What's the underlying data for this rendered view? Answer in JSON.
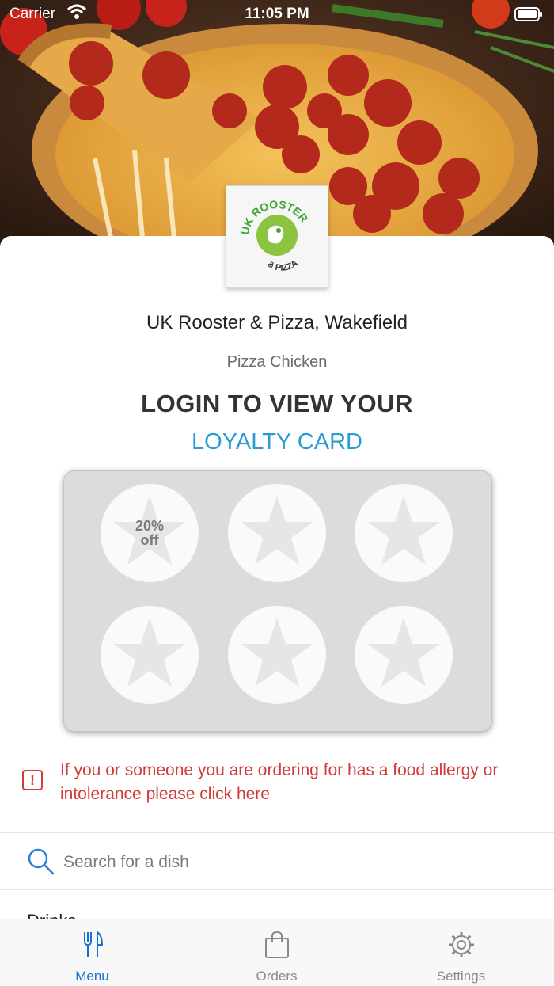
{
  "status_bar": {
    "carrier": "Carrier",
    "time": "11:05 PM"
  },
  "restaurant": {
    "logo_top": "UK ROOSTER",
    "logo_bottom": "& PIZZA",
    "name": "UK Rooster & Pizza, Wakefield",
    "cuisine": "Pizza Chicken"
  },
  "loyalty": {
    "heading": "LOGIN TO VIEW YOUR",
    "subheading": "LOYALTY CARD",
    "reward_percent": "20%",
    "reward_off": "off",
    "stamps_total": 6
  },
  "allergy": {
    "icon": "alert-icon",
    "message": "If you or someone you are ordering for has a food allergy or intolerance please click here"
  },
  "search": {
    "placeholder": "Search for a dish"
  },
  "menu_next_category": "Drinks",
  "tabs": [
    {
      "label": "Menu",
      "icon": "fork-knife-icon",
      "active": true
    },
    {
      "label": "Orders",
      "icon": "bag-icon",
      "active": false
    },
    {
      "label": "Settings",
      "icon": "gear-icon",
      "active": false
    }
  ],
  "colors": {
    "accent": "#2a9bd3",
    "alert": "#d33a3a",
    "tab_active": "#1a6fd0",
    "logo_green": "#3fa535"
  }
}
